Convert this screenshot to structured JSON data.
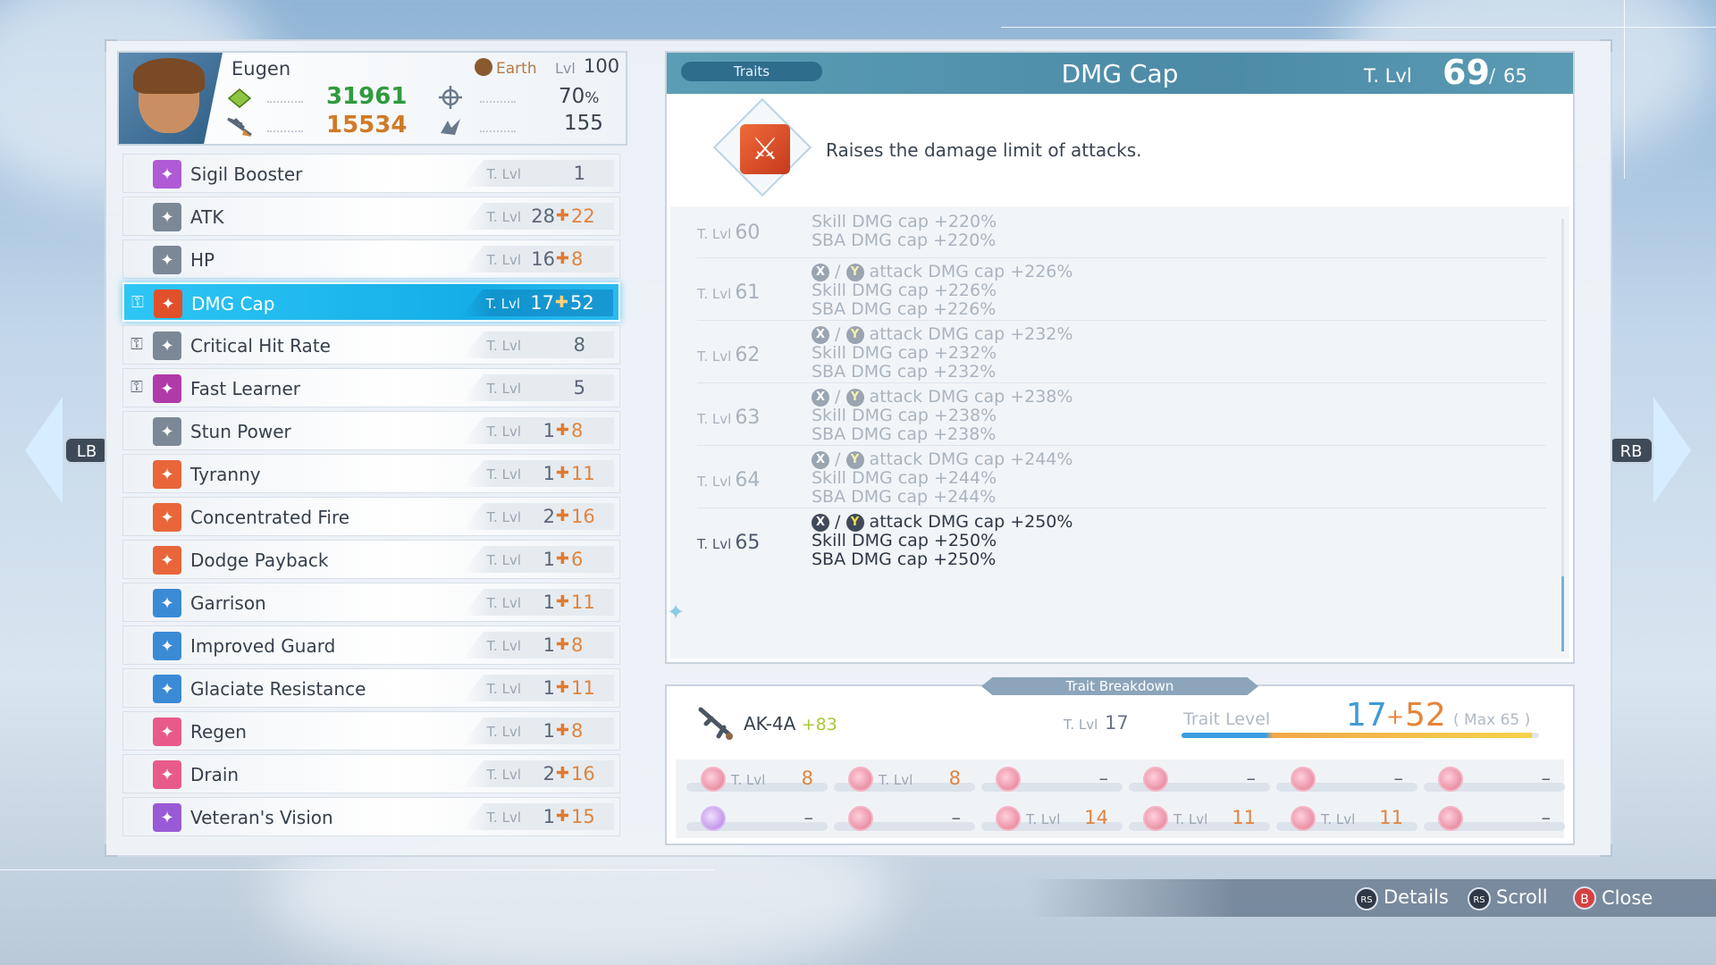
{
  "character": {
    "name": "Eugen",
    "element": "Earth",
    "level_label": "Lvl",
    "level": "100",
    "power": "31961",
    "power_color": "#2f9a3e",
    "crit_rate": "70",
    "crit_rate_unit": "%",
    "attack_power": "15534",
    "attack_color": "#d07a26",
    "stun": "155"
  },
  "trait_list": [
    {
      "name": "Sigil Booster",
      "icon": "sigil-booster-icon",
      "color": "#b05ad6",
      "base": "1",
      "bonus": "",
      "locked": false,
      "active": false
    },
    {
      "name": "ATK",
      "icon": "atk-sword-icon",
      "color": "#7c8896",
      "base": "28",
      "bonus": "22",
      "locked": false,
      "active": false
    },
    {
      "name": "HP",
      "icon": "hp-heart-icon",
      "color": "#7c8896",
      "base": "16",
      "bonus": "8",
      "locked": false,
      "active": false
    },
    {
      "name": "DMG Cap",
      "icon": "dmg-cap-icon",
      "color": "#e0502a",
      "base": "17",
      "bonus": "52",
      "locked": true,
      "active": true
    },
    {
      "name": "Critical Hit Rate",
      "icon": "critical-hit-icon",
      "color": "#7c8896",
      "base": "8",
      "bonus": "",
      "locked": true,
      "active": false
    },
    {
      "name": "Fast Learner",
      "icon": "fast-learner-icon",
      "color": "#b03aa8",
      "base": "5",
      "bonus": "",
      "locked": true,
      "active": false
    },
    {
      "name": "Stun Power",
      "icon": "stun-power-icon",
      "color": "#7c8896",
      "base": "1",
      "bonus": "8",
      "locked": false,
      "active": false
    },
    {
      "name": "Tyranny",
      "icon": "tyranny-icon",
      "color": "#e8663a",
      "base": "1",
      "bonus": "11",
      "locked": false,
      "active": false
    },
    {
      "name": "Concentrated Fire",
      "icon": "concentrated-fire-icon",
      "color": "#e8663a",
      "base": "2",
      "bonus": "16",
      "locked": false,
      "active": false
    },
    {
      "name": "Dodge Payback",
      "icon": "dodge-payback-icon",
      "color": "#e8663a",
      "base": "1",
      "bonus": "6",
      "locked": false,
      "active": false
    },
    {
      "name": "Garrison",
      "icon": "garrison-shield-icon",
      "color": "#3a8ad6",
      "base": "1",
      "bonus": "11",
      "locked": false,
      "active": false
    },
    {
      "name": "Improved Guard",
      "icon": "improved-guard-icon",
      "color": "#3a8ad6",
      "base": "1",
      "bonus": "8",
      "locked": false,
      "active": false
    },
    {
      "name": "Glaciate Resistance",
      "icon": "glaciate-resistance-icon",
      "color": "#3a8ad6",
      "base": "1",
      "bonus": "11",
      "locked": false,
      "active": false
    },
    {
      "name": "Regen",
      "icon": "regen-icon",
      "color": "#e85a8a",
      "base": "1",
      "bonus": "8",
      "locked": false,
      "active": false
    },
    {
      "name": "Drain",
      "icon": "drain-icon",
      "color": "#e85a8a",
      "base": "2",
      "bonus": "16",
      "locked": false,
      "active": false
    },
    {
      "name": "Veteran's Vision",
      "icon": "veterans-vision-icon",
      "color": "#9a5ad6",
      "base": "1",
      "bonus": "15",
      "locked": false,
      "active": false
    }
  ],
  "trait_level_label": "T. Lvl",
  "detail": {
    "tab": "Traits",
    "title": "DMG Cap",
    "tlvl_label": "T. Lvl",
    "current": "69",
    "separator": "/",
    "max": "65",
    "description": "Raises the damage limit of attacks.",
    "levels": [
      {
        "level": "60",
        "lines": [
          "Skill DMG cap +220%",
          "SBA DMG cap +220%"
        ],
        "button_line": "",
        "current": false
      },
      {
        "level": "61",
        "button_line": "attack DMG cap +226%",
        "lines": [
          "Skill DMG cap +226%",
          "SBA DMG cap +226%"
        ],
        "current": false
      },
      {
        "level": "62",
        "button_line": "attack DMG cap +232%",
        "lines": [
          "Skill DMG cap +232%",
          "SBA DMG cap +232%"
        ],
        "current": false
      },
      {
        "level": "63",
        "button_line": "attack DMG cap +238%",
        "lines": [
          "Skill DMG cap +238%",
          "SBA DMG cap +238%"
        ],
        "current": false
      },
      {
        "level": "64",
        "button_line": "attack DMG cap +244%",
        "lines": [
          "Skill DMG cap +244%",
          "SBA DMG cap +244%"
        ],
        "current": false
      },
      {
        "level": "65",
        "button_line": "attack DMG cap +250%",
        "lines": [
          "Skill DMG cap +250%",
          "SBA DMG cap +250%"
        ],
        "current": true
      }
    ],
    "btn_x": "X",
    "btn_y": "Y",
    "btn_sep": "/"
  },
  "breakdown": {
    "tab": "Trait Breakdown",
    "weapon_name": "AK-4A",
    "weapon_plus": "+83",
    "weapon_tlvl": "17",
    "trait_level_label": "Trait Level",
    "total_base": "17",
    "total_plus": "+",
    "total_bonus": "52",
    "max_text": "( Max 65 )",
    "bar_fraction": 0.98,
    "sigils": [
      {
        "tlvl": "8",
        "has_tl": true,
        "icon": "sigil-pink"
      },
      {
        "tlvl": "8",
        "has_tl": true,
        "icon": "sigil-pink"
      },
      {
        "tlvl": "–",
        "has_tl": false,
        "icon": "sigil-pink"
      },
      {
        "tlvl": "–",
        "has_tl": false,
        "icon": "sigil-pink"
      },
      {
        "tlvl": "–",
        "has_tl": false,
        "icon": "sigil-pink"
      },
      {
        "tlvl": "–",
        "has_tl": false,
        "icon": "sigil-pink"
      },
      {
        "tlvl": "–",
        "has_tl": false,
        "icon": "sigil-purple"
      },
      {
        "tlvl": "–",
        "has_tl": false,
        "icon": "sigil-pink"
      },
      {
        "tlvl": "14",
        "has_tl": true,
        "icon": "sigil-pink"
      },
      {
        "tlvl": "11",
        "has_tl": true,
        "icon": "sigil-pink"
      },
      {
        "tlvl": "11",
        "has_tl": true,
        "icon": "sigil-pink"
      },
      {
        "tlvl": "–",
        "has_tl": false,
        "icon": "sigil-pink"
      }
    ]
  },
  "nav": {
    "left": "LB",
    "right": "RB"
  },
  "footer": {
    "details_btn": "RS",
    "details": "Details",
    "scroll_btn": "RS",
    "scroll": "Scroll",
    "close_btn": "B",
    "close": "Close"
  }
}
